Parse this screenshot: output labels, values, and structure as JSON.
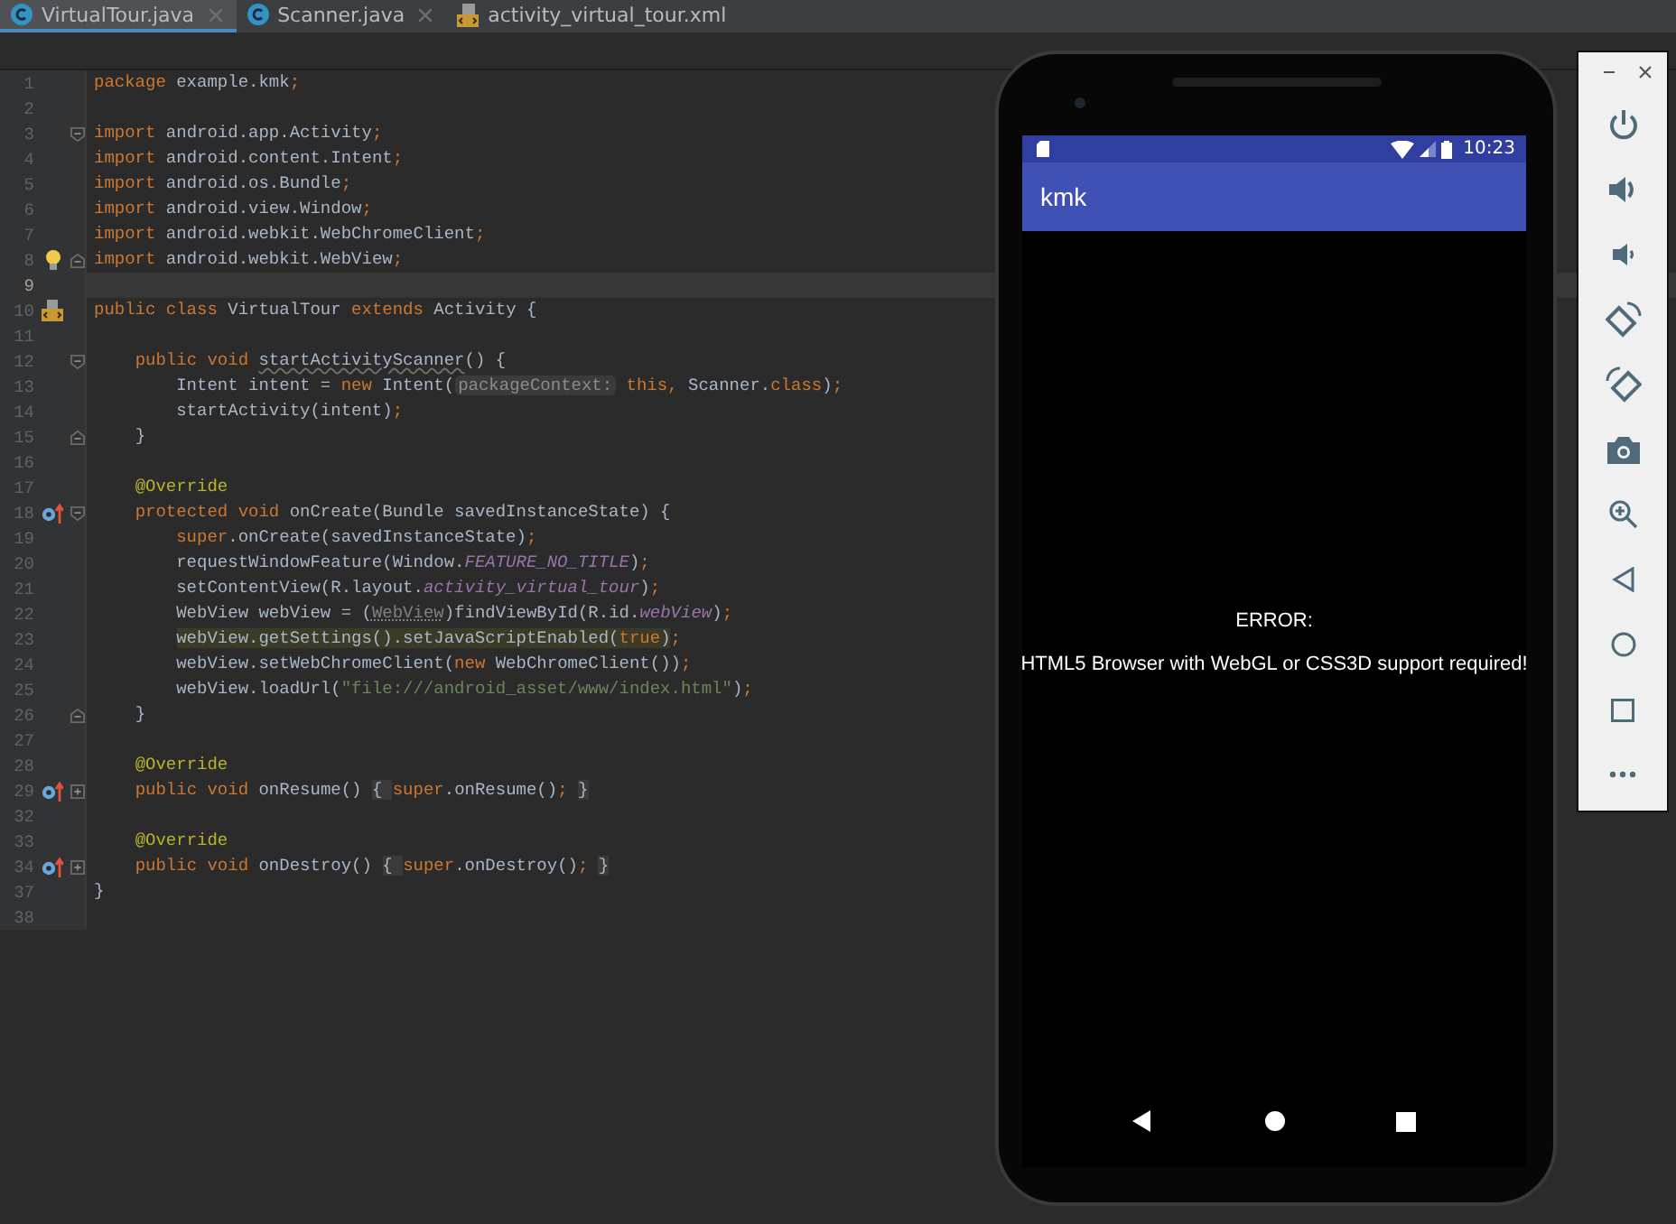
{
  "tabs": [
    {
      "label": "VirtualTour.java",
      "kind": "class",
      "selected": true,
      "closable": true
    },
    {
      "label": "Scanner.java",
      "kind": "class",
      "selected": false,
      "closable": true
    },
    {
      "label": "activity_virtual_tour.xml",
      "kind": "xml",
      "selected": false,
      "closable": false
    }
  ],
  "editor": {
    "lines": [
      {
        "number": "1",
        "current": false,
        "tokens": [
          {
            "kind": "kw",
            "text": "package "
          },
          {
            "kind": "plain",
            "text": "example.kmk"
          },
          {
            "kind": "kw",
            "text": ";"
          }
        ]
      },
      {
        "number": "2",
        "current": false
      },
      {
        "number": "3",
        "current": false,
        "icons": [
          {
            "kind": "fold-start"
          }
        ],
        "tokens": [
          {
            "kind": "kw",
            "text": "import "
          },
          {
            "kind": "plain",
            "text": "android.app.Activity"
          },
          {
            "kind": "kw",
            "text": ";"
          }
        ]
      },
      {
        "number": "4",
        "current": false,
        "tokens": [
          {
            "kind": "kw",
            "text": "import "
          },
          {
            "kind": "plain",
            "text": "android.content.Intent"
          },
          {
            "kind": "kw",
            "text": ";"
          }
        ]
      },
      {
        "number": "5",
        "current": false,
        "tokens": [
          {
            "kind": "kw",
            "text": "import "
          },
          {
            "kind": "plain",
            "text": "android.os.Bundle"
          },
          {
            "kind": "kw",
            "text": ";"
          }
        ]
      },
      {
        "number": "6",
        "current": false,
        "tokens": [
          {
            "kind": "kw",
            "text": "import "
          },
          {
            "kind": "plain",
            "text": "android.view.Window"
          },
          {
            "kind": "kw",
            "text": ";"
          }
        ]
      },
      {
        "number": "7",
        "current": false,
        "tokens": [
          {
            "kind": "kw",
            "text": "import "
          },
          {
            "kind": "plain",
            "text": "android.webkit.WebChromeClient"
          },
          {
            "kind": "kw",
            "text": ";"
          }
        ]
      },
      {
        "number": "8",
        "current": false,
        "icons": [
          {
            "kind": "bulb"
          },
          {
            "kind": "fold-end"
          }
        ],
        "tokens": [
          {
            "kind": "kw",
            "text": "import "
          },
          {
            "kind": "plain",
            "text": "android.webkit.WebView"
          },
          {
            "kind": "kw",
            "text": ";"
          }
        ]
      },
      {
        "number": "9",
        "current": true
      },
      {
        "number": "10",
        "current": false,
        "icons": [
          {
            "kind": "layout"
          }
        ],
        "tokens": [
          {
            "kind": "kw",
            "text": "public class "
          },
          {
            "kind": "plain",
            "text": "VirtualTour "
          },
          {
            "kind": "kw",
            "text": "extends "
          },
          {
            "kind": "plain",
            "text": "Activity {"
          }
        ]
      },
      {
        "number": "11",
        "current": false
      },
      {
        "number": "12",
        "current": false,
        "icons": [
          {
            "kind": "fold-start"
          }
        ],
        "tokens": [
          {
            "kind": "kw",
            "text": "    public void "
          },
          {
            "kind": "unused",
            "text": "startActivityScanner"
          },
          {
            "kind": "plain",
            "text": "() {"
          }
        ]
      },
      {
        "number": "13",
        "current": false,
        "tokens": [
          {
            "kind": "plain",
            "text": "        Intent intent = "
          },
          {
            "kind": "kw",
            "text": "new "
          },
          {
            "kind": "plain",
            "text": "Intent("
          },
          {
            "kind": "hint",
            "text": "packageContext:"
          },
          {
            "kind": "kw",
            "text": " this, "
          },
          {
            "kind": "plain",
            "text": "Scanner."
          },
          {
            "kind": "kw",
            "text": "class"
          },
          {
            "kind": "plain",
            "text": ")"
          },
          {
            "kind": "kw",
            "text": ";"
          }
        ]
      },
      {
        "number": "14",
        "current": false,
        "tokens": [
          {
            "kind": "plain",
            "text": "        startActivity(intent)"
          },
          {
            "kind": "kw",
            "text": ";"
          }
        ]
      },
      {
        "number": "15",
        "current": false,
        "icons": [
          {
            "kind": "fold-end"
          }
        ],
        "tokens": [
          {
            "kind": "plain",
            "text": "    }"
          }
        ]
      },
      {
        "number": "16",
        "current": false
      },
      {
        "number": "17",
        "current": false,
        "tokens": [
          {
            "kind": "annotation",
            "text": "    @Override"
          }
        ]
      },
      {
        "number": "18",
        "current": false,
        "icons": [
          {
            "kind": "override"
          },
          {
            "kind": "fold-start"
          }
        ],
        "tokens": [
          {
            "kind": "kw",
            "text": "    protected void "
          },
          {
            "kind": "plain",
            "text": "onCreate(Bundle savedInstanceState) {"
          }
        ]
      },
      {
        "number": "19",
        "current": false,
        "tokens": [
          {
            "kind": "kw",
            "text": "        super"
          },
          {
            "kind": "plain",
            "text": ".onCreate(savedInstanceState)"
          },
          {
            "kind": "kw",
            "text": ";"
          }
        ]
      },
      {
        "number": "20",
        "current": false,
        "tokens": [
          {
            "kind": "plain",
            "text": "        requestWindowFeature(Window."
          },
          {
            "kind": "field",
            "text": "FEATURE_NO_TITLE"
          },
          {
            "kind": "plain",
            "text": ")"
          },
          {
            "kind": "kw",
            "text": ";"
          }
        ]
      },
      {
        "number": "21",
        "current": false,
        "tokens": [
          {
            "kind": "plain",
            "text": "        setContentView(R.layout."
          },
          {
            "kind": "field",
            "text": "activity_virtual_tour"
          },
          {
            "kind": "plain",
            "text": ")"
          },
          {
            "kind": "kw",
            "text": ";"
          }
        ]
      },
      {
        "number": "22",
        "current": false,
        "tokens": [
          {
            "kind": "plain",
            "text": "        WebView webView = ("
          },
          {
            "kind": "redundant",
            "text": "WebView"
          },
          {
            "kind": "plain",
            "text": ")findViewById(R.id."
          },
          {
            "kind": "field",
            "text": "webView"
          },
          {
            "kind": "plain",
            "text": ")"
          },
          {
            "kind": "kw",
            "text": ";"
          }
        ]
      },
      {
        "number": "23",
        "current": false,
        "tokens": [
          {
            "kind": "marked",
            "text": "        webView.getSettings().setJavaScriptEnabled("
          },
          {
            "kind": "markedkw",
            "text": "true"
          },
          {
            "kind": "marked",
            "text": ")"
          },
          {
            "kind": "kw",
            "text": ";"
          }
        ]
      },
      {
        "number": "24",
        "current": false,
        "tokens": [
          {
            "kind": "plain",
            "text": "        webView.setWebChromeClient("
          },
          {
            "kind": "kw",
            "text": "new "
          },
          {
            "kind": "plain",
            "text": "WebChromeClient())"
          },
          {
            "kind": "kw",
            "text": ";"
          }
        ]
      },
      {
        "number": "25",
        "current": false,
        "tokens": [
          {
            "kind": "plain",
            "text": "        webView.loadUrl("
          },
          {
            "kind": "string",
            "text": "\"file:///android_asset/www/index.html\""
          },
          {
            "kind": "plain",
            "text": ")"
          },
          {
            "kind": "kw",
            "text": ";"
          }
        ]
      },
      {
        "number": "26",
        "current": false,
        "icons": [
          {
            "kind": "fold-end"
          }
        ],
        "tokens": [
          {
            "kind": "plain",
            "text": "    }"
          }
        ]
      },
      {
        "number": "27",
        "current": false
      },
      {
        "number": "28",
        "current": false,
        "tokens": [
          {
            "kind": "annotation",
            "text": "    @Override"
          }
        ]
      },
      {
        "number": "29",
        "current": false,
        "icons": [
          {
            "kind": "override"
          },
          {
            "kind": "fold-collapsed"
          }
        ],
        "tokens": [
          {
            "kind": "kw",
            "text": "    public void "
          },
          {
            "kind": "plain",
            "text": "onResume() "
          },
          {
            "kind": "folded",
            "text": "{ "
          },
          {
            "kind": "kw",
            "text": "super"
          },
          {
            "kind": "plain",
            "text": ".onResume()"
          },
          {
            "kind": "kw",
            "text": ";"
          },
          {
            "kind": "folded",
            "text": " }"
          }
        ]
      },
      {
        "number": "32",
        "current": false
      },
      {
        "number": "33",
        "current": false,
        "tokens": [
          {
            "kind": "annotation",
            "text": "    @Override"
          }
        ]
      },
      {
        "number": "34",
        "current": false,
        "icons": [
          {
            "kind": "override"
          },
          {
            "kind": "fold-collapsed"
          }
        ],
        "tokens": [
          {
            "kind": "kw",
            "text": "    public void "
          },
          {
            "kind": "plain",
            "text": "onDestroy() "
          },
          {
            "kind": "folded",
            "text": "{ "
          },
          {
            "kind": "kw",
            "text": "super"
          },
          {
            "kind": "plain",
            "text": ".onDestroy()"
          },
          {
            "kind": "kw",
            "text": ";"
          },
          {
            "kind": "folded",
            "text": " }"
          }
        ]
      },
      {
        "number": "37",
        "current": false,
        "tokens": [
          {
            "kind": "plain",
            "text": "}"
          }
        ]
      },
      {
        "number": "38",
        "current": false
      }
    ]
  },
  "device": {
    "time": "10:23",
    "app_title": "kmk",
    "messages": [
      "ERROR:",
      "HTML5 Browser with WebGL or CSS3D support required!"
    ]
  },
  "emulator_toolbar": {
    "items": [
      {
        "kind": "power"
      },
      {
        "kind": "volume-up"
      },
      {
        "kind": "volume-down"
      },
      {
        "kind": "rotate-left"
      },
      {
        "kind": "rotate-right"
      },
      {
        "kind": "camera"
      },
      {
        "kind": "zoom"
      },
      {
        "kind": "back"
      },
      {
        "kind": "home"
      },
      {
        "kind": "overview"
      },
      {
        "kind": "more"
      }
    ]
  }
}
